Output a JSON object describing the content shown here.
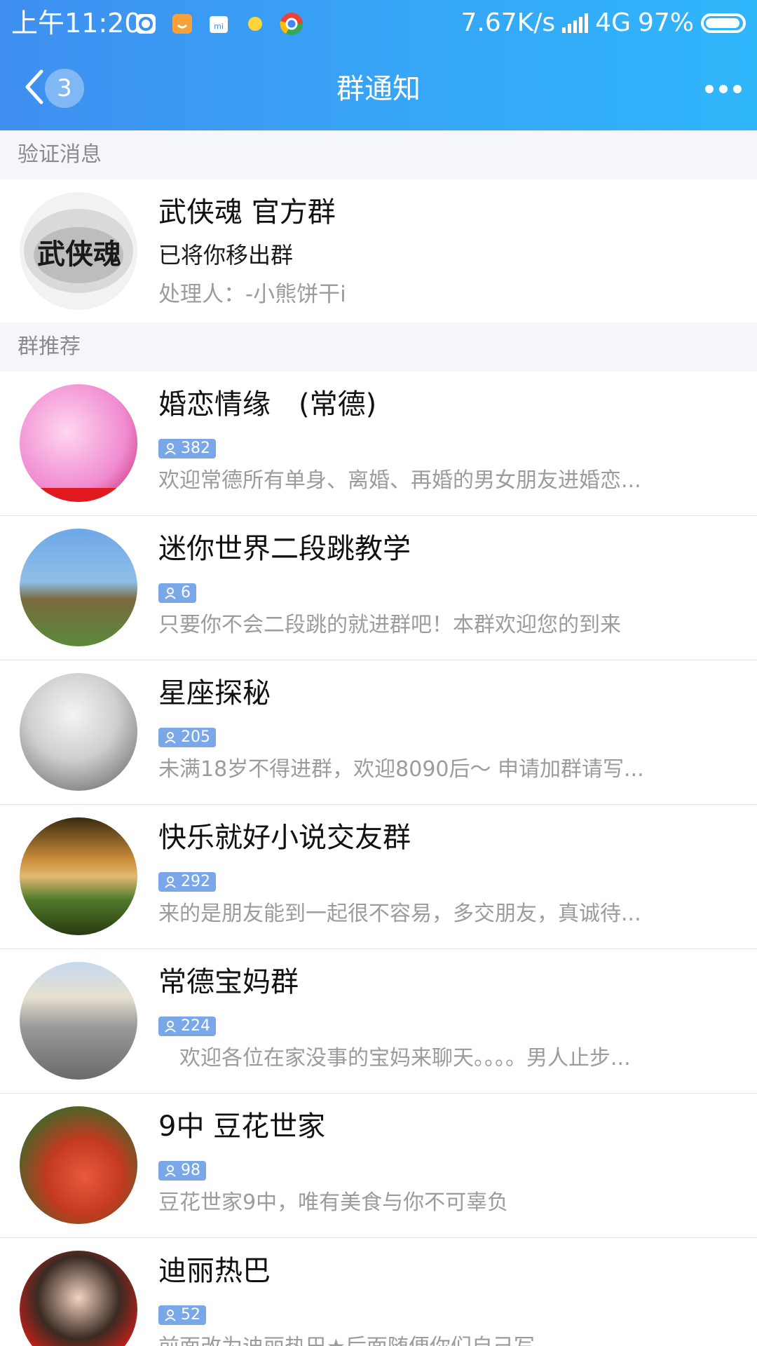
{
  "status_bar": {
    "time": "上午11:20",
    "network_speed": "7.67K/s",
    "network_type": "4G",
    "battery": "97%"
  },
  "navbar": {
    "back_badge": "3",
    "title": "群通知"
  },
  "sections": {
    "verify_label": "验证消息",
    "recommend_label": "群推荐"
  },
  "verify_message": {
    "group_name": "武侠魂 官方群",
    "status": "已将你移出群",
    "handler": "处理人：-小熊饼干i",
    "avatar_text": "武侠魂"
  },
  "recommendations": [
    {
      "name": "婚恋情缘　(常德)",
      "members": "382",
      "desc": "欢迎常德所有单身、离婚、再婚的男女朋友进婚恋..."
    },
    {
      "name": "迷你世界二段跳教学",
      "members": "6",
      "desc": "只要你不会二段跳的就进群吧！本群欢迎您的到来"
    },
    {
      "name": "星座探秘",
      "members": "205",
      "desc": "未满18岁不得进群，欢迎8090后～  申请加群请写..."
    },
    {
      "name": "快乐就好小说交友群",
      "members": "292",
      "desc": "来的是朋友能到一起很不容易，多交朋友，真诚待..."
    },
    {
      "name": "常德宝妈群",
      "members": "224",
      "desc": "　欢迎各位在家没事的宝妈来聊天。。。。男人止步..."
    },
    {
      "name": "9中  豆花世家",
      "members": "98",
      "desc": "豆花世家9中，唯有美食与你不可辜负"
    },
    {
      "name": "迪丽热巴",
      "members": "52",
      "desc": "前面改为迪丽热巴★后面随便你们自己写"
    }
  ],
  "colors": {
    "header_start": "#3f8ff0",
    "header_end": "#2fb6fb",
    "member_badge": "#7aa7e8",
    "secondary_text": "#9b9ba0"
  }
}
